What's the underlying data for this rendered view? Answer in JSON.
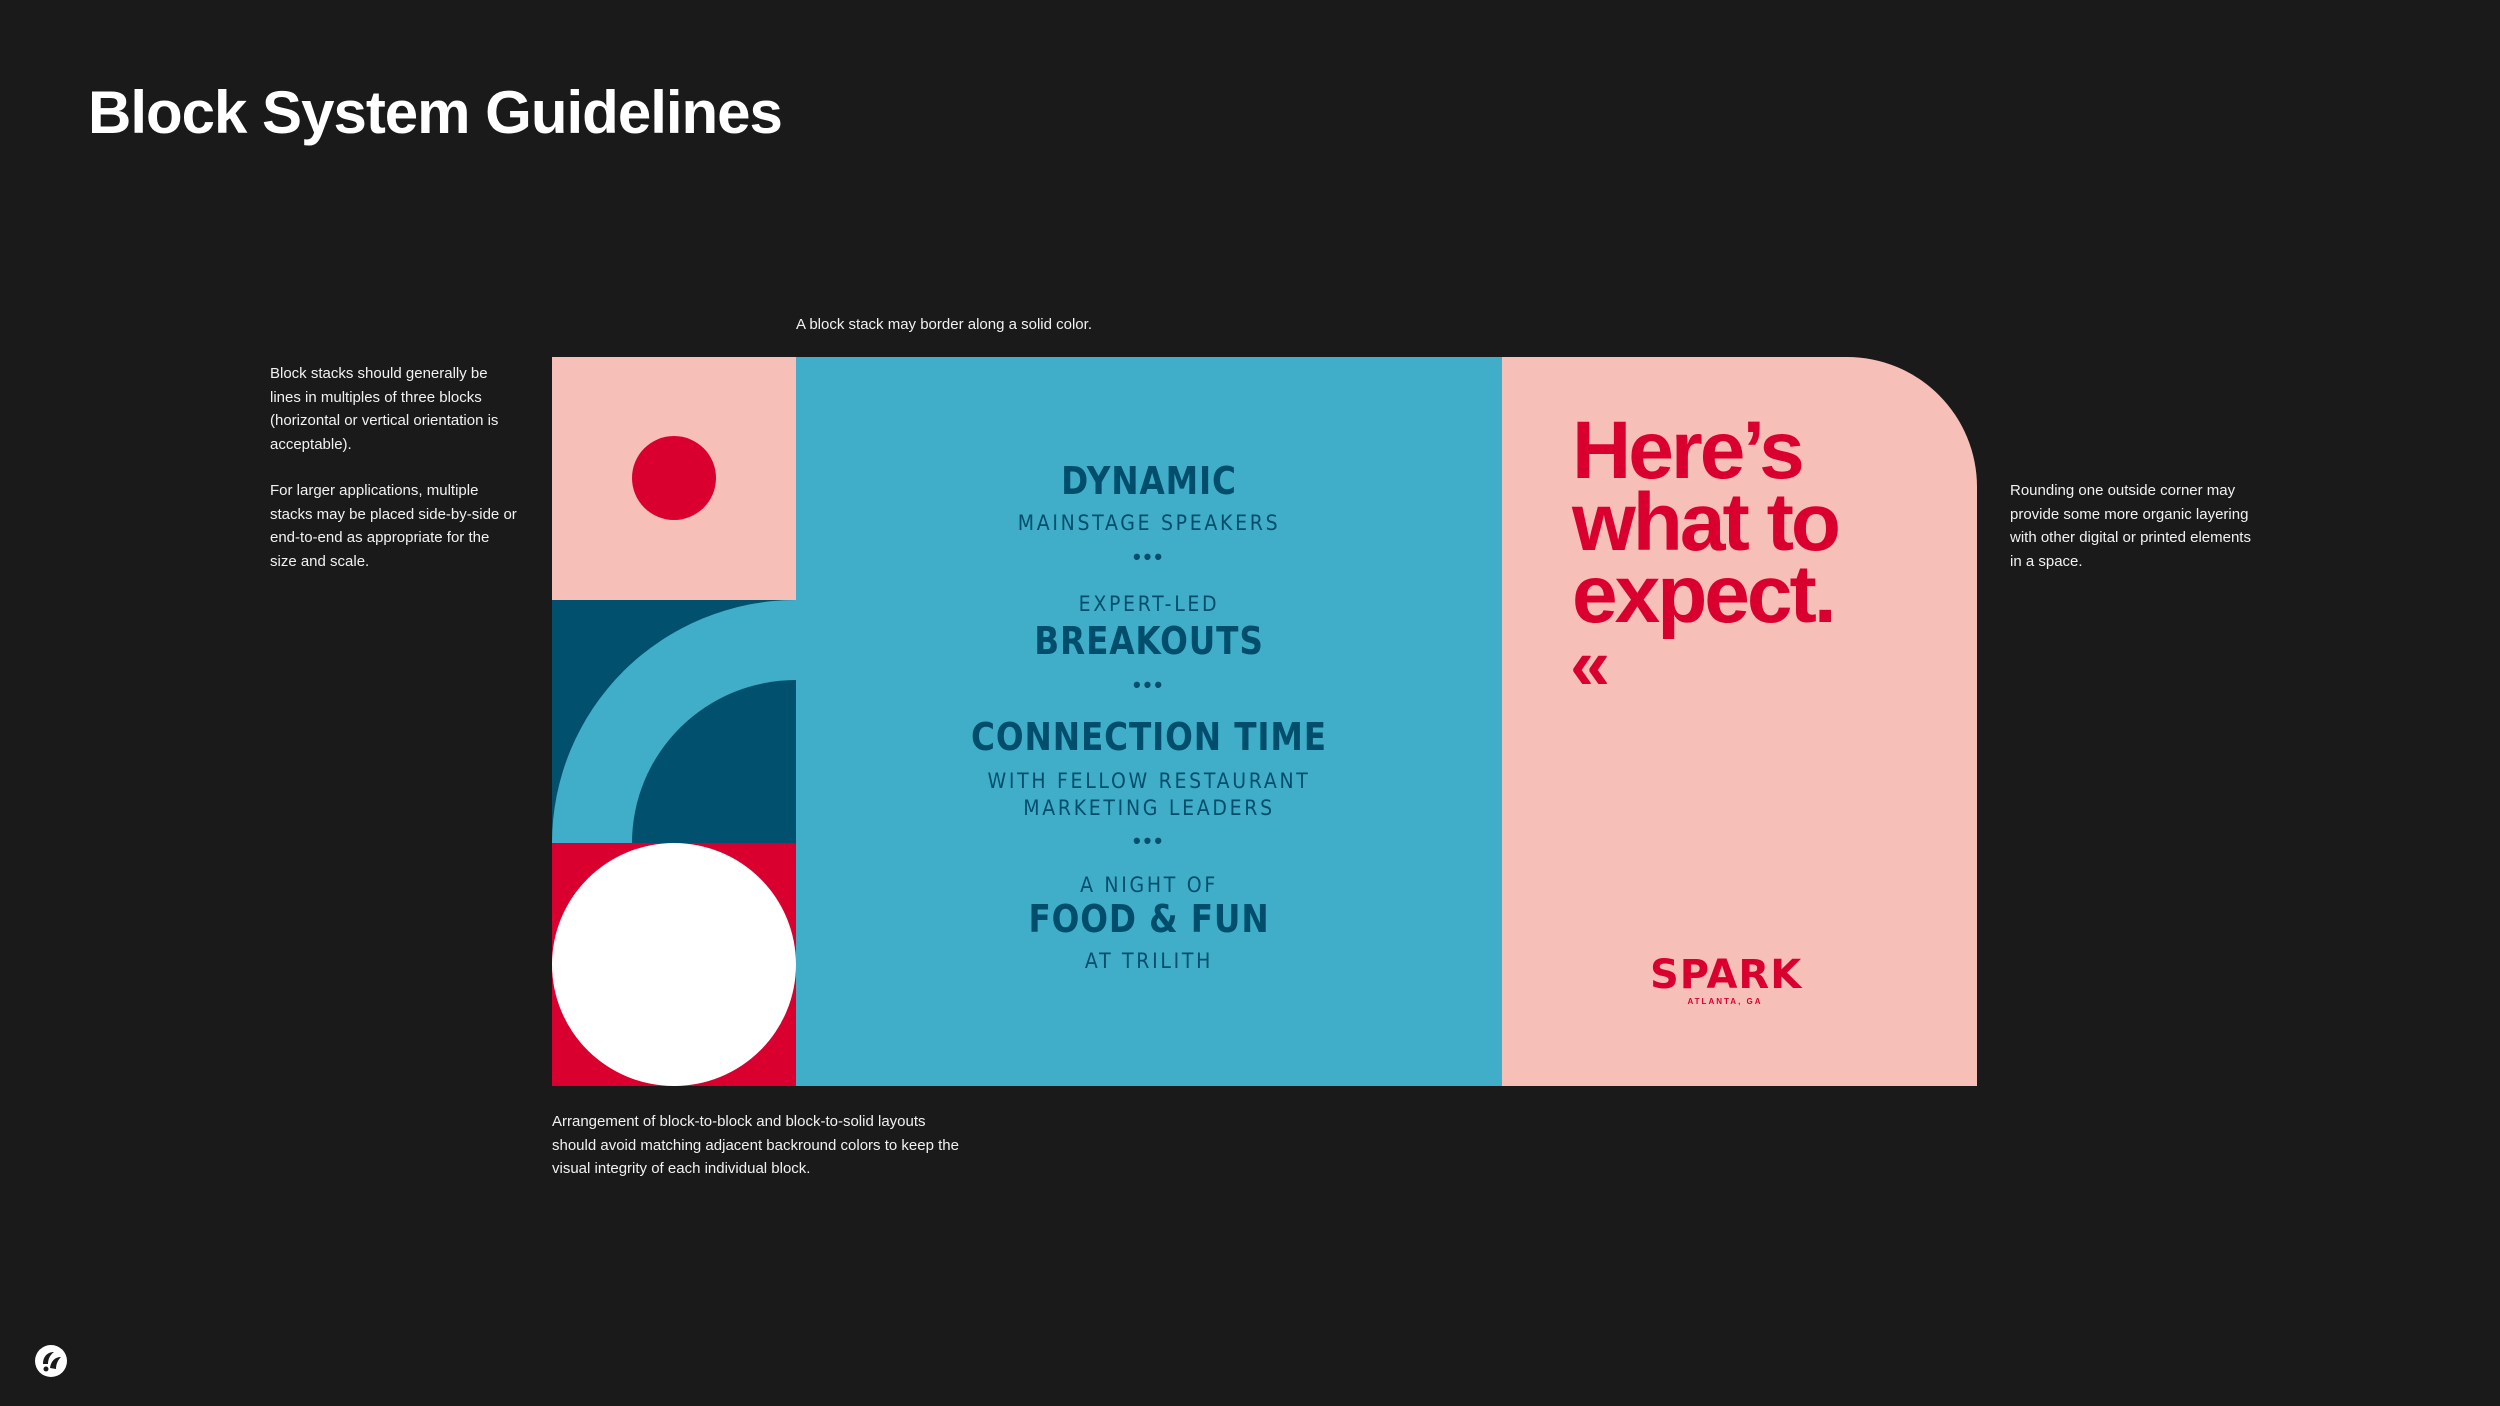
{
  "page": {
    "title": "Block System Guidelines"
  },
  "notes": {
    "left_p1": "Block stacks should generally be lines in multiples of three blocks (horizontal or vertical orientation is acceptable).",
    "left_p2": "For larger applications, multiple stacks may be placed side-by-side or end-to-end as appropriate for the size and scale.",
    "top": "A block stack may border along a solid color.",
    "right": "Rounding one outside corner may provide some more organic layering with other digital or printed elements in a space.",
    "bottom": "Arrangement of block-to-block and block-to-solid layouts should avoid matching adjacent backround colors to keep the visual integrity of each individual block."
  },
  "agenda": {
    "item1_title": "DYNAMIC",
    "item1_sub": "MAINSTAGE SPEAKERS",
    "sep": "•••",
    "item2_pre": "EXPERT-LED",
    "item2_title": "BREAKOUTS",
    "item3_title": "CONNECTION TIME",
    "item3_sub1": "WITH FELLOW RESTAURANT",
    "item3_sub2": "MARKETING LEADERS",
    "item4_pre": "A NIGHT OF",
    "item4_title": "FOOD & FUN",
    "item4_sub": "AT TRILITH"
  },
  "promo": {
    "headline_l1": "Here’s",
    "headline_l2": "what to",
    "headline_l3": "expect.",
    "chevron": "«",
    "brand": "SPARK",
    "location": "ATLANTA, GA"
  },
  "colors": {
    "background": "#1a1a1a",
    "pink": "#f6bfb8",
    "red": "#d9002f",
    "navy": "#00506e",
    "teal": "#40aec8",
    "white": "#ffffff"
  },
  "icons": {
    "footer_logo": "brand-logo-icon"
  }
}
